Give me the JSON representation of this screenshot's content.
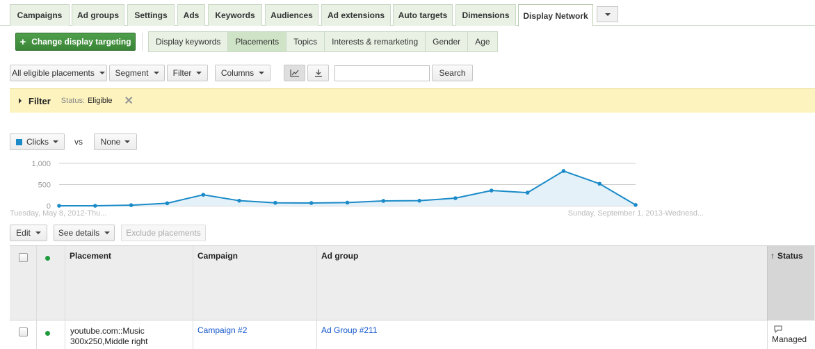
{
  "tabs": [
    {
      "label": "Campaigns",
      "active": false
    },
    {
      "label": "Ad groups",
      "active": false
    },
    {
      "label": "Settings",
      "active": false
    },
    {
      "label": "Ads",
      "active": false
    },
    {
      "label": "Keywords",
      "active": false
    },
    {
      "label": "Audiences",
      "active": false
    },
    {
      "label": "Ad extensions",
      "active": false
    },
    {
      "label": "Auto targets",
      "active": false
    },
    {
      "label": "Dimensions",
      "active": false
    },
    {
      "label": "Display Network",
      "active": true
    }
  ],
  "targeting_button": {
    "label": "Change display targeting"
  },
  "subtabs": [
    {
      "label": "Display keywords",
      "active": false
    },
    {
      "label": "Placements",
      "active": true
    },
    {
      "label": "Topics",
      "active": false
    },
    {
      "label": "Interests & remarketing",
      "active": false
    },
    {
      "label": "Gender",
      "active": false
    },
    {
      "label": "Age",
      "active": false
    }
  ],
  "toolbar": {
    "placements_dropdown": "All eligible placements",
    "segment": "Segment",
    "filter": "Filter",
    "columns": "Columns",
    "search_value": "",
    "search_button": "Search"
  },
  "filter_bar": {
    "title": "Filter",
    "status_label": "Status:",
    "status_value": "Eligible"
  },
  "chart_controls": {
    "metric1": "Clicks",
    "vs": "vs",
    "metric2": "None",
    "metric1_color": "#1a8ac8"
  },
  "chart_data": {
    "type": "area",
    "series": [
      {
        "name": "Clicks",
        "values": [
          0,
          0,
          15,
          60,
          260,
          120,
          70,
          65,
          75,
          115,
          120,
          180,
          360,
          310,
          820,
          520,
          20
        ]
      }
    ],
    "ylim": [
      0,
      1000
    ],
    "yticks": [
      "1,000",
      "500",
      "0"
    ],
    "x_start_label": "Tuesday, May 8, 2012-Thu...",
    "x_end_label": "Sunday, September 1, 2013-Wednesd...",
    "grid": true,
    "color": "#1a8ac8"
  },
  "table_controls": {
    "edit": "Edit",
    "see_details": "See details",
    "exclude": "Exclude placements"
  },
  "table": {
    "headers": {
      "placement": "Placement",
      "campaign": "Campaign",
      "ad_group": "Ad group",
      "status": "Status"
    },
    "rows": [
      {
        "placement_line1": "youtube.com::Music",
        "placement_line2": "300x250,Middle right",
        "campaign": "Campaign #2",
        "ad_group": "Ad Group #211",
        "status": "Managed"
      }
    ]
  }
}
